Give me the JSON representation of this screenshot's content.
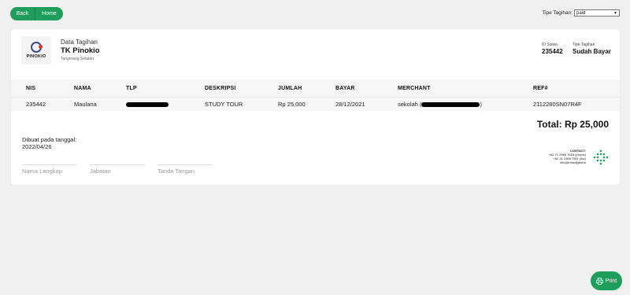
{
  "nav": {
    "back_label": "Back",
    "home_label": "Home"
  },
  "filter": {
    "label": "Tipe Tagihan:",
    "selected": "paid"
  },
  "invoice": {
    "logo_text": "PINOKIO",
    "subtitle": "Data Tagihan",
    "school_name": "TK Pinokio",
    "city": "Tangerang Selatan",
    "id_siswa_label": "ID Siswa",
    "id_siswa": "235442",
    "tipe_label": "Tipe Tagihan",
    "tipe_value": "Sudah Bayar"
  },
  "table": {
    "headers": [
      "NIS",
      "NAMA",
      "TLP",
      "DESKRIPSI",
      "JUMLAH",
      "BAYAR",
      "MERCHANT",
      "REF#"
    ],
    "rows": [
      {
        "nis": "235442",
        "nama": "Maulana",
        "deskripsi": "STUDY TOUR",
        "jumlah": "Rp 25,000",
        "bayar": "28/12/2021",
        "merchant_prefix": "sekolah (",
        "merchant_suffix": ")",
        "ref": "2112280SN07R4F"
      }
    ]
  },
  "total": "Total: Rp 25,000",
  "created": {
    "label": "Dibuat pada tanggal:",
    "date": "2022/04/26"
  },
  "contact": {
    "title": "CONTACT:",
    "phone": "+62 21 2966 7618 (phone)",
    "fax": "+62 21 2966 7501 (fax)",
    "email": "info@infradigital.io"
  },
  "signature": {
    "name": "Nama Lengkap",
    "position": "Jabatan",
    "sign": "Tanda Tangan"
  },
  "print_label": "Print",
  "colors": {
    "accent": "#1e9e5a",
    "dots": "#1e9e5a"
  }
}
